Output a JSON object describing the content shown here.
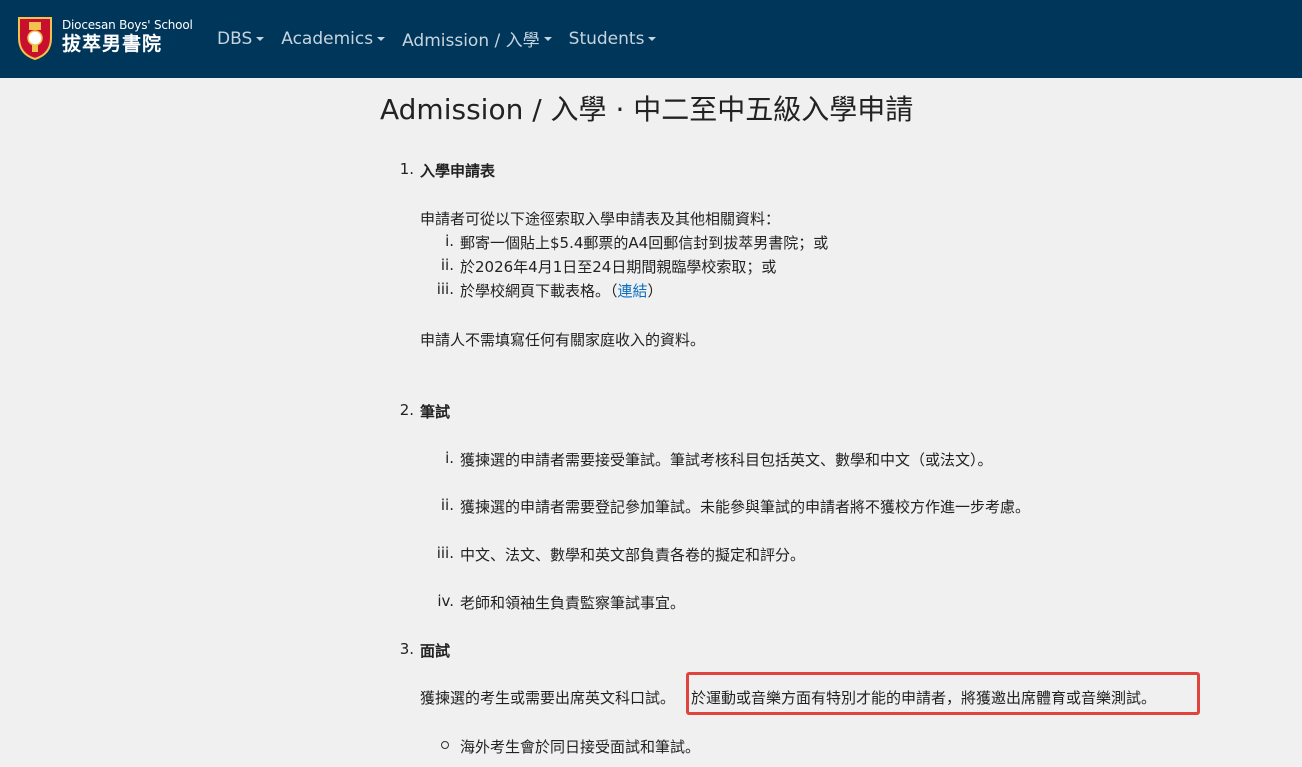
{
  "brand": {
    "name_en": "Diocesan Boys' School",
    "name_zh": "拔萃男書院"
  },
  "nav": {
    "items": [
      {
        "label": "DBS"
      },
      {
        "label": "Academics"
      },
      {
        "label": "Admission / 入學"
      },
      {
        "label": "Students"
      }
    ]
  },
  "page": {
    "title": "Admission / 入學 · 中二至中五級入學申請"
  },
  "sections": {
    "s1": {
      "number": "1.",
      "heading": "入學申請表",
      "intro": "申請者可從以下途徑索取入學申請表及其他相關資料：",
      "items": [
        {
          "marker": "i.",
          "text": "郵寄一個貼上$5.4郵票的A4回郵信封到拔萃男書院；或"
        },
        {
          "marker": "ii.",
          "text": "於2026年4月1日至24日期間親臨學校索取；或"
        },
        {
          "marker": "iii.",
          "text": "於學校網頁下載表格。（",
          "link": "連結",
          "after": "）"
        }
      ],
      "note": "申請人不需填寫任何有關家庭收入的資料。"
    },
    "s2": {
      "number": "2.",
      "heading": "筆試",
      "items": [
        {
          "marker": "i.",
          "text": "獲揀選的申請者需要接受筆試。筆試考核科目包括英文、數學和中文（或法文）。"
        },
        {
          "marker": "ii.",
          "text": "獲揀選的申請者需要登記參加筆試。未能參與筆試的申請者將不獲校方作進一步考慮。"
        },
        {
          "marker": "iii.",
          "text": "中文、法文、數學和英文部負責各卷的擬定和評分。"
        },
        {
          "marker": "iv.",
          "text": "老師和領袖生負責監察筆試事宜。"
        }
      ]
    },
    "s3": {
      "number": "3.",
      "heading": "面試",
      "text_a": "獲揀選的考生或需要出席英文科口試。",
      "text_b": "於運動或音樂方面有特別才能的申請者，將獲邀出席體育或音樂測試。",
      "bullet": "海外考生會於同日接受面試和筆試。"
    }
  },
  "colors": {
    "navbar": "#00365a",
    "nav_text": "#c6d4df",
    "page_bg": "#f0f0f0",
    "link": "#0a6fc2",
    "highlight": "#e0443e"
  }
}
